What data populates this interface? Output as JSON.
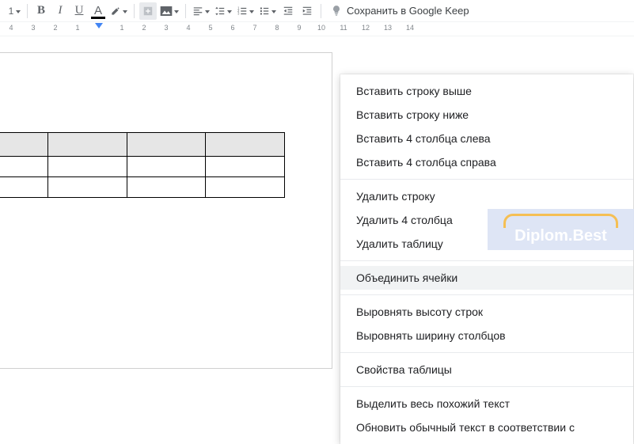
{
  "toolbar": {
    "zoom_label": "1",
    "bold": "B",
    "italic": "I",
    "underline": "U",
    "text_color": "A",
    "keep_label": "Сохранить в Google Keep"
  },
  "ruler": {
    "numbers": [
      "4",
      "3",
      "2",
      "1",
      "",
      "1",
      "2",
      "3",
      "4",
      "5",
      "6",
      "7",
      "8",
      "9",
      "10",
      "11",
      "12",
      "13",
      "14"
    ]
  },
  "table": {
    "rows": 3,
    "cols": 4
  },
  "context_menu": {
    "groups": [
      [
        "Вставить строку выше",
        "Вставить строку ниже",
        "Вставить 4 столбца слева",
        "Вставить 4 столбца справа"
      ],
      [
        "Удалить строку",
        "Удалить 4 столбца",
        "Удалить таблицу"
      ],
      [
        "Объединить ячейки"
      ],
      [
        "Выровнять высоту строк",
        "Выровнять ширину столбцов"
      ],
      [
        "Свойства таблицы"
      ],
      [
        "Выделить весь похожий текст",
        "Обновить обычный текст в соответствии с"
      ]
    ],
    "highlighted": "Объединить ячейки"
  },
  "watermark": "Diplom.Best"
}
